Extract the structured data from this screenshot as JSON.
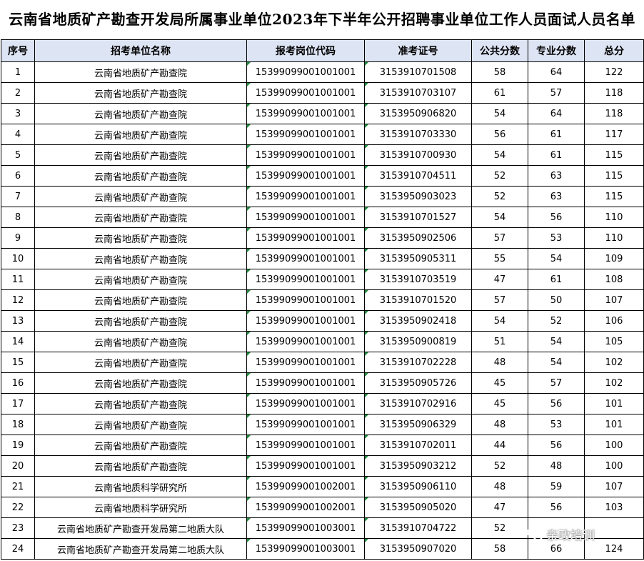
{
  "title": "云南省地质矿产勘查开发局所属事业单位2023年下半年公开招聘事业单位工作人员面试人员名单",
  "headers": [
    "序号",
    "招考单位名称",
    "报考岗位代码",
    "准考证号",
    "公共分数",
    "专业分数",
    "总分"
  ],
  "rows": [
    [
      "1",
      "云南省地质矿产勘查院",
      "15399099001001001",
      "3153910701508",
      "58",
      "64",
      "122"
    ],
    [
      "2",
      "云南省地质矿产勘查院",
      "15399099001001001",
      "3153910703107",
      "61",
      "57",
      "118"
    ],
    [
      "3",
      "云南省地质矿产勘查院",
      "15399099001001001",
      "3153950906820",
      "54",
      "64",
      "118"
    ],
    [
      "4",
      "云南省地质矿产勘查院",
      "15399099001001001",
      "3153910703330",
      "56",
      "61",
      "117"
    ],
    [
      "5",
      "云南省地质矿产勘查院",
      "15399099001001001",
      "3153910700930",
      "54",
      "61",
      "115"
    ],
    [
      "6",
      "云南省地质矿产勘查院",
      "15399099001001001",
      "3153910704511",
      "52",
      "63",
      "115"
    ],
    [
      "7",
      "云南省地质矿产勘查院",
      "15399099001001001",
      "3153950903023",
      "52",
      "63",
      "115"
    ],
    [
      "8",
      "云南省地质矿产勘查院",
      "15399099001001001",
      "3153910701527",
      "54",
      "56",
      "110"
    ],
    [
      "9",
      "云南省地质矿产勘查院",
      "15399099001001001",
      "3153950902506",
      "57",
      "53",
      "110"
    ],
    [
      "10",
      "云南省地质矿产勘查院",
      "15399099001001001",
      "3153950905311",
      "55",
      "54",
      "109"
    ],
    [
      "11",
      "云南省地质矿产勘查院",
      "15399099001001001",
      "3153910703519",
      "47",
      "61",
      "108"
    ],
    [
      "12",
      "云南省地质矿产勘查院",
      "15399099001001001",
      "3153910701520",
      "57",
      "50",
      "107"
    ],
    [
      "13",
      "云南省地质矿产勘查院",
      "15399099001001001",
      "3153950902418",
      "54",
      "52",
      "106"
    ],
    [
      "14",
      "云南省地质矿产勘查院",
      "15399099001001001",
      "3153950900819",
      "51",
      "54",
      "105"
    ],
    [
      "15",
      "云南省地质矿产勘查院",
      "15399099001001001",
      "3153910702228",
      "48",
      "54",
      "102"
    ],
    [
      "16",
      "云南省地质矿产勘查院",
      "15399099001001001",
      "3153950905726",
      "45",
      "57",
      "102"
    ],
    [
      "17",
      "云南省地质矿产勘查院",
      "15399099001001001",
      "3153910702916",
      "45",
      "56",
      "101"
    ],
    [
      "18",
      "云南省地质矿产勘查院",
      "15399099001001001",
      "3153950906329",
      "48",
      "53",
      "101"
    ],
    [
      "19",
      "云南省地质矿产勘查院",
      "15399099001001001",
      "3153910702011",
      "44",
      "56",
      "100"
    ],
    [
      "20",
      "云南省地质矿产勘查院",
      "15399099001001001",
      "3153950903212",
      "52",
      "48",
      "100"
    ],
    [
      "21",
      "云南省地质科学研究所",
      "15399099001002001",
      "3153950906110",
      "48",
      "59",
      "107"
    ],
    [
      "22",
      "云南省地质科学研究所",
      "15399099001002001",
      "3153950905020",
      "47",
      "56",
      "103"
    ],
    [
      "23",
      "云南省地质矿产勘查开发局第二地质大队",
      "15399099001003001",
      "3153910704722",
      "52",
      "",
      ""
    ],
    [
      "24",
      "云南省地质矿产勘查开发局第二地质大队",
      "15399099001003001",
      "3153950907020",
      "58",
      "66",
      "124"
    ]
  ],
  "watermark": {
    "icon": "wechat-icon",
    "text": "亲政培训"
  },
  "colors": {
    "header_bg": "#dde4f3",
    "cell_marker": "#1e8a3a"
  }
}
